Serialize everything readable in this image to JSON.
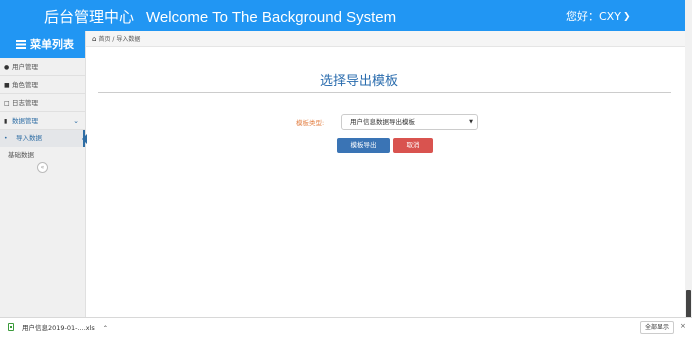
{
  "header": {
    "title_cn": "后台管理中心",
    "title_en": "Welcome To The Background System",
    "greeting": "您好：CXY"
  },
  "sidebar": {
    "title": "菜单列表",
    "items": [
      {
        "label": "用户管理",
        "icon": "user-icon"
      },
      {
        "label": "角色管理",
        "icon": "folder-icon"
      },
      {
        "label": "日志管理",
        "icon": "calendar-icon"
      },
      {
        "label": "数据管理",
        "icon": "book-icon",
        "expanded": true
      }
    ],
    "sub_items": [
      {
        "label": "导入数据",
        "selected": true
      },
      {
        "label": "基础数据",
        "selected": false
      }
    ]
  },
  "breadcrumb": {
    "home": "首页",
    "separator": "/",
    "current": "导入数据"
  },
  "main": {
    "title": "选择导出模板",
    "form": {
      "label": "模板类型:",
      "selected_value": "用户信息数据导出模板"
    },
    "export_button": "模板导出",
    "cancel_button": "取消"
  },
  "download_bar": {
    "file_name": "用户信息2019-01-....xls",
    "show_all": "全部显示",
    "close": "×"
  },
  "colors": {
    "header_bg": "#2196f3",
    "title_blue": "#2a6cae",
    "label_orange": "#e4844a",
    "export_btn": "#3a74b5",
    "cancel_btn": "#d9534f"
  }
}
